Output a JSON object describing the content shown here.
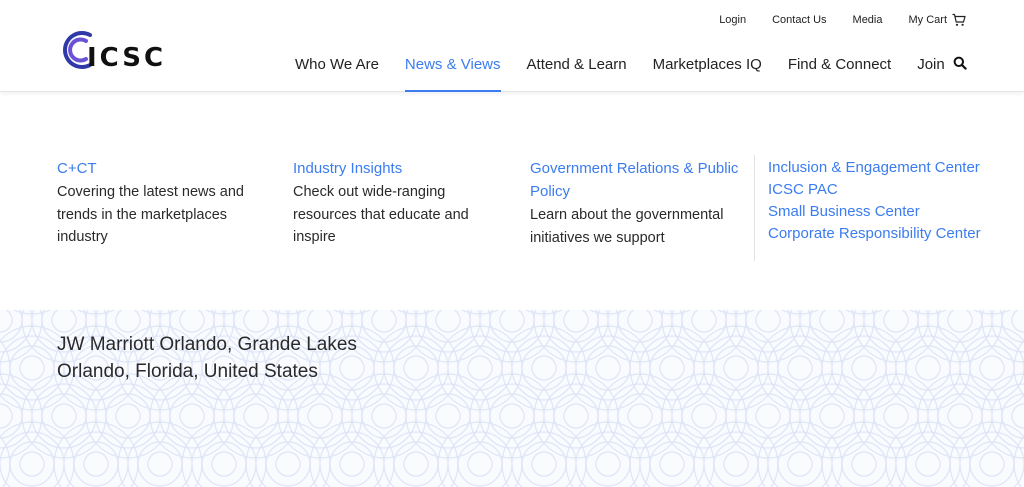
{
  "brand": {
    "name": "ICSC",
    "logo_text": "ICSC",
    "accent": "#3b7cf0",
    "logo_colors": [
      "#2f3aa8",
      "#6a52d6"
    ]
  },
  "utility_nav": [
    {
      "label": "Login"
    },
    {
      "label": "Contact Us"
    },
    {
      "label": "Media"
    },
    {
      "label": "My Cart",
      "icon": "cart-icon"
    }
  ],
  "main_nav": [
    {
      "label": "Who We Are",
      "active": false
    },
    {
      "label": "News & Views",
      "active": true
    },
    {
      "label": "Attend & Learn",
      "active": false
    },
    {
      "label": "Marketplaces IQ",
      "active": false
    },
    {
      "label": "Find & Connect",
      "active": false
    },
    {
      "label": "Join",
      "active": false
    }
  ],
  "search": {
    "icon": "search-icon"
  },
  "mega_menu": {
    "columns": [
      {
        "title": "C+CT",
        "description": "Covering the latest news and trends in the marketplaces industry"
      },
      {
        "title": "Industry Insights",
        "description": "Check out wide-ranging resources that educate and inspire"
      },
      {
        "title": "Government Relations & Public Policy",
        "description": "Learn about the governmental initiatives we support"
      }
    ],
    "links": [
      "Inclusion & Engagement Center",
      "ICSC PAC",
      "Small Business Center",
      "Corporate Responsibility Center"
    ]
  },
  "venue": {
    "line1": "JW Marriott Orlando, Grande Lakes",
    "line2": "Orlando, Florida, United States"
  }
}
